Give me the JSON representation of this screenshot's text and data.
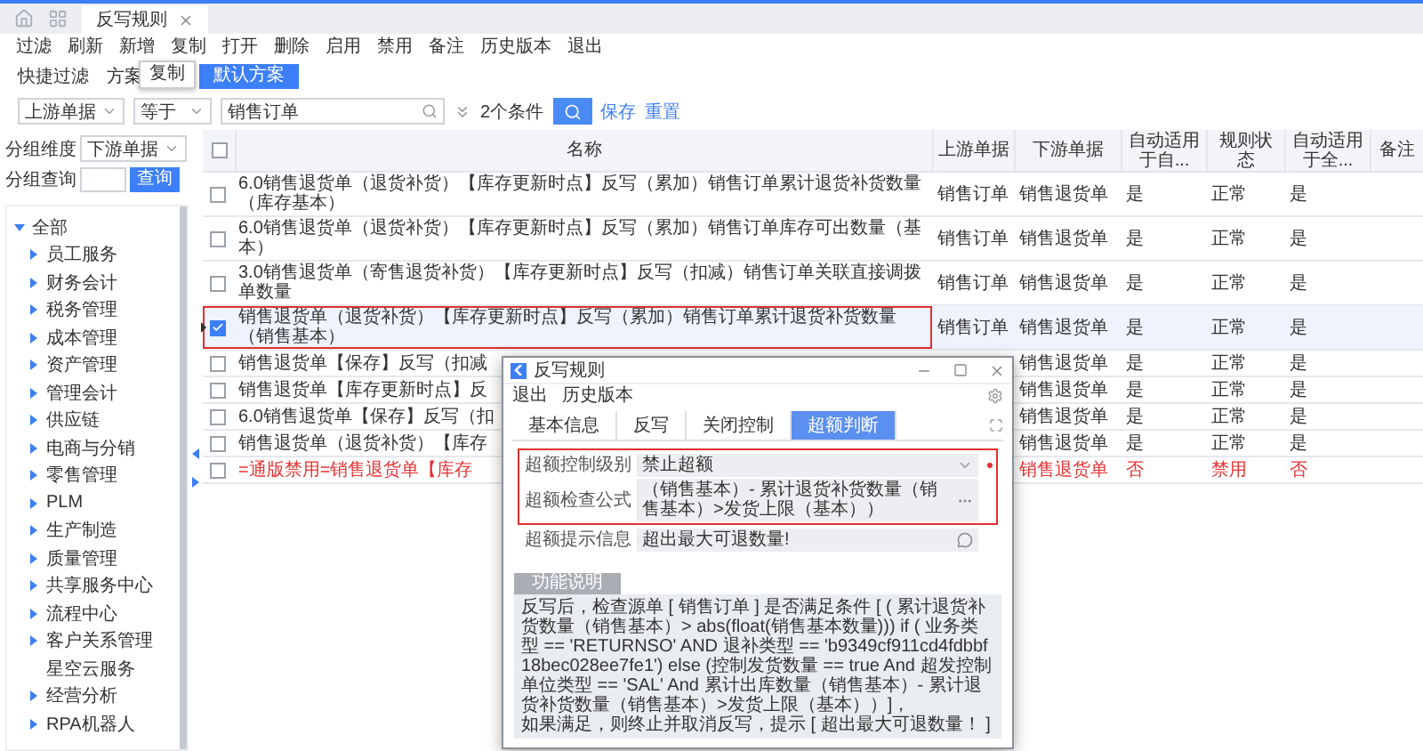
{
  "app_tabs": [
    {
      "label": "反写规则",
      "selected": true
    }
  ],
  "menu": [
    "过滤",
    "刷新",
    "新增",
    "复制",
    "打开",
    "删除",
    "启用",
    "禁用",
    "备注",
    "历史版本",
    "退出"
  ],
  "tooltip": "复制",
  "quick_filter": {
    "label": "快捷过滤",
    "scheme_label": "方案",
    "scheme_button": "默认方案"
  },
  "filter": {
    "field": "上游单据",
    "operator": "等于",
    "value": "销售订单",
    "condition_count": "2个条件",
    "save": "保存",
    "reset": "重置"
  },
  "grouping": {
    "dimension_label": "分组维度",
    "dimension_value": "下游单据",
    "query_label": "分组查询",
    "query_button": "查询"
  },
  "tree": {
    "label": "全部",
    "expanded": true,
    "children": [
      {
        "label": "员工服务",
        "has_children": true
      },
      {
        "label": "财务会计",
        "has_children": true
      },
      {
        "label": "税务管理",
        "has_children": true
      },
      {
        "label": "成本管理",
        "has_children": true
      },
      {
        "label": "资产管理",
        "has_children": true
      },
      {
        "label": "管理会计",
        "has_children": true
      },
      {
        "label": "供应链",
        "has_children": true
      },
      {
        "label": "电商与分销",
        "has_children": true
      },
      {
        "label": "零售管理",
        "has_children": true
      },
      {
        "label": "PLM",
        "has_children": true
      },
      {
        "label": "生产制造",
        "has_children": true
      },
      {
        "label": "质量管理",
        "has_children": true
      },
      {
        "label": "共享服务中心",
        "has_children": true
      },
      {
        "label": "流程中心",
        "has_children": true
      },
      {
        "label": "客户关系管理",
        "has_children": true
      },
      {
        "label": "星空云服务",
        "has_children": false
      },
      {
        "label": "经营分析",
        "has_children": true
      },
      {
        "label": "RPA机器人",
        "has_children": true
      }
    ]
  },
  "table": {
    "header_checked": false,
    "columns": [
      "名称",
      "上游单据",
      "下游单据",
      "自动适用于自...",
      "规则状态",
      "自动适用于全...",
      "备注"
    ],
    "rows": [
      {
        "checked": false,
        "selected": false,
        "highlighted": false,
        "disabled": false,
        "name": "6.0销售退货单（退货补货）【库存更新时点】反写（累加）销售订单累计退货补货数量（库存基本）",
        "upstream": "销售订单",
        "downstream": "销售退货单",
        "auto_self": "是",
        "status": "正常",
        "auto_all": "是"
      },
      {
        "checked": false,
        "selected": false,
        "highlighted": false,
        "disabled": false,
        "name": "6.0销售退货单（退货补货）【库存更新时点】反写（累加）销售订单库存可出数量（基本）",
        "upstream": "销售订单",
        "downstream": "销售退货单",
        "auto_self": "是",
        "status": "正常",
        "auto_all": "是"
      },
      {
        "checked": false,
        "selected": false,
        "highlighted": false,
        "disabled": false,
        "name": "3.0销售退货单（寄售退货补货）【库存更新时点】反写（扣减）销售订单关联直接调拨单数量",
        "upstream": "销售订单",
        "downstream": "销售退货单",
        "auto_self": "是",
        "status": "正常",
        "auto_all": "是"
      },
      {
        "checked": true,
        "selected": true,
        "highlighted": true,
        "disabled": false,
        "name": "销售退货单（退货补货）【库存更新时点】反写（累加）销售订单累计退货补货数量（销售基本）",
        "upstream": "销售订单",
        "downstream": "销售退货单",
        "auto_self": "是",
        "status": "正常",
        "auto_all": "是"
      },
      {
        "checked": false,
        "selected": false,
        "highlighted": false,
        "disabled": false,
        "name": "销售退货单【保存】反写（扣减",
        "downstream": "销售退货单",
        "auto_self": "是",
        "status": "正常",
        "auto_all": "是"
      },
      {
        "checked": false,
        "selected": false,
        "highlighted": false,
        "disabled": false,
        "name": "销售退货单【库存更新时点】反",
        "downstream": "销售退货单",
        "auto_self": "是",
        "status": "正常",
        "auto_all": "是"
      },
      {
        "checked": false,
        "selected": false,
        "highlighted": false,
        "disabled": false,
        "name": "6.0销售退货单【保存】反写（扣",
        "downstream": "销售退货单",
        "auto_self": "是",
        "status": "正常",
        "auto_all": "是"
      },
      {
        "checked": false,
        "selected": false,
        "highlighted": false,
        "disabled": false,
        "name": "销售退货单（退货补货）【库存",
        "downstream": "销售退货单",
        "auto_self": "是",
        "status": "正常",
        "auto_all": "是"
      },
      {
        "checked": false,
        "selected": false,
        "highlighted": false,
        "disabled": true,
        "name": "=通版禁用=销售退货单【库存",
        "downstream": "销售退货单",
        "auto_self": "否",
        "status": "禁用",
        "auto_all": "否"
      }
    ]
  },
  "dialog": {
    "title": "反写规则",
    "menu": [
      "退出",
      "历史版本"
    ],
    "tabs": [
      {
        "label": "基本信息",
        "selected": false
      },
      {
        "label": "反写",
        "selected": false
      },
      {
        "label": "关闭控制",
        "selected": false
      },
      {
        "label": "超额判断",
        "selected": true
      }
    ],
    "fields": [
      {
        "kind": "select",
        "label": "超额控制级别",
        "value": "禁止超额",
        "required": true,
        "highlighted": true
      },
      {
        "kind": "formula",
        "label": "超额检查公式",
        "value": "（销售基本）- 累计退货补货数量（销售基本）>发货上限（基本））",
        "required": false,
        "highlighted": true
      },
      {
        "kind": "text",
        "label": "超额提示信息",
        "value": "超出最大可退数量!",
        "required": false,
        "highlighted": false
      }
    ],
    "description": {
      "label": "功能说明",
      "paragraphs": [
        "反写后，检查源单 [ 销售订单 ] 是否满足条件 [ ( 累计退货补货数量（销售基本）> abs(float(销售基本数量))) if ( 业务类型 == 'RETURNSO' AND 退补类型 == 'b9349cf911cd4fdbbf18bec028ee7fe1')   else (控制发货数量 == true And  超发控制单位类型 == 'SAL'  And   累计出库数量（销售基本）- 累计退货补货数量（销售基本）>发货上限（基本））]，",
        "如果满足，则终止并取消反写，提示 [ 超出最大可退数量！ ]"
      ]
    }
  }
}
